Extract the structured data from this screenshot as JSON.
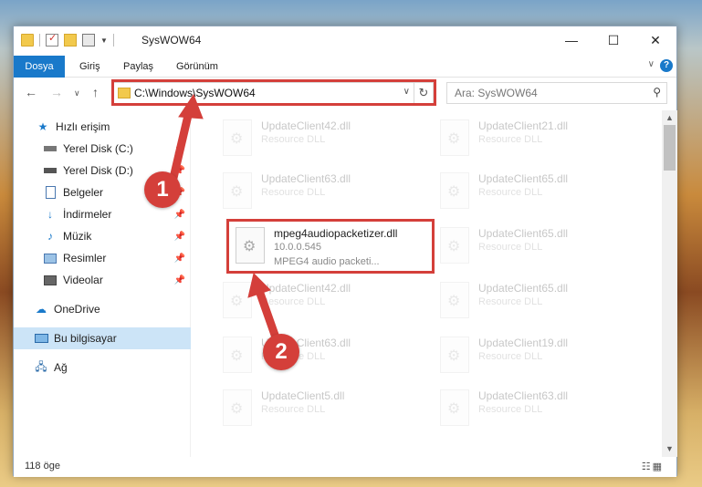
{
  "window": {
    "title": "SysWOW64",
    "controls": {
      "minimize": "—",
      "maximize": "☐",
      "close": "✕"
    }
  },
  "ribbon": {
    "tabs": [
      "Dosya",
      "Giriş",
      "Paylaş",
      "Görünüm"
    ],
    "expand": "∨",
    "help": "?"
  },
  "nav": {
    "address": "C:\\Windows\\SysWOW64",
    "search_placeholder": "Ara: SysWOW64"
  },
  "sidebar": {
    "items": [
      {
        "label": "Hızlı erişim",
        "icon": "star-icon"
      },
      {
        "label": "Yerel Disk (C:)",
        "icon": "drive-icon",
        "pinned": true
      },
      {
        "label": "Yerel Disk (D:)",
        "icon": "drive-icon",
        "pinned": true
      },
      {
        "label": "Belgeler",
        "icon": "documents-icon",
        "pinned": true
      },
      {
        "label": "İndirmeler",
        "icon": "download-icon",
        "pinned": true
      },
      {
        "label": "Müzik",
        "icon": "music-icon",
        "pinned": true
      },
      {
        "label": "Resimler",
        "icon": "pictures-icon",
        "pinned": true
      },
      {
        "label": "Videolar",
        "icon": "videos-icon",
        "pinned": true
      },
      {
        "label": "OneDrive",
        "icon": "cloud-icon"
      },
      {
        "label": "Bu bilgisayar",
        "icon": "computer-icon",
        "selected": true
      },
      {
        "label": "Ağ",
        "icon": "network-icon"
      }
    ]
  },
  "files": [
    {
      "name": "UpdateClient42.dll",
      "desc": "Resource DLL"
    },
    {
      "name": "UpdateClient21.dll",
      "desc": "Resource DLL"
    },
    {
      "name": "UpdateClient63.dll",
      "desc": "Resource DLL"
    },
    {
      "name": "UpdateClient65.dll",
      "desc": "Resource DLL"
    },
    {
      "name": "mpeg4audiopacketizer.dll",
      "version": "10.0.0.545",
      "desc": "MPEG4 audio packeti..."
    },
    {
      "name": "UpdateClient65.dll",
      "desc": "Resource DLL"
    },
    {
      "name": "UpdateClient42.dll",
      "desc": "Resource DLL"
    },
    {
      "name": "UpdateClient65.dll",
      "desc": "Resource DLL"
    },
    {
      "name": "UpdateClient63.dll",
      "desc": "Resource DLL"
    },
    {
      "name": "UpdateClient19.dll",
      "desc": "Resource DLL"
    },
    {
      "name": "UpdateClient5.dll",
      "desc": "Resource DLL"
    },
    {
      "name": "UpdateClient63.dll",
      "desc": "Resource DLL"
    }
  ],
  "status": {
    "count": "118 öge"
  },
  "callouts": [
    "1",
    "2"
  ],
  "colors": {
    "accent": "#1979ca",
    "highlight": "#d43f3a",
    "selected": "#cce4f7"
  }
}
